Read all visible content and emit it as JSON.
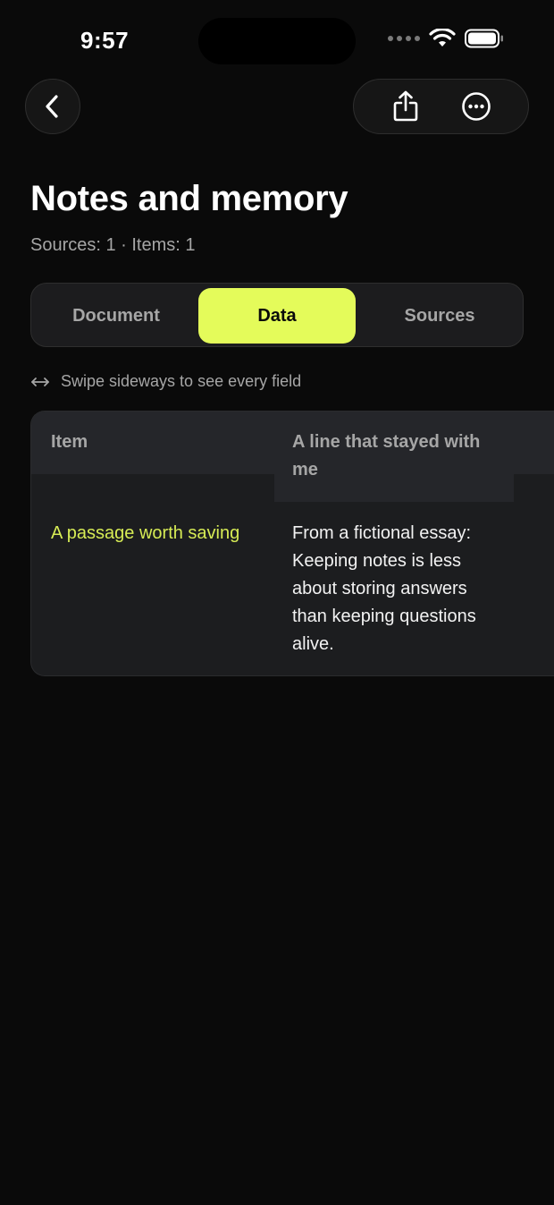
{
  "status_bar": {
    "time": "9:57"
  },
  "nav": {
    "back_icon": "chevron-left-icon",
    "share_icon": "share-icon",
    "more_icon": "ellipsis-circle-icon"
  },
  "page": {
    "title": "Notes and memory",
    "meta": "Sources: 1 · Items: 1"
  },
  "tabs": [
    {
      "label": "Document",
      "active": false
    },
    {
      "label": "Data",
      "active": true
    },
    {
      "label": "Sources",
      "active": false
    }
  ],
  "hint": {
    "icon": "swap-horizontal-icon",
    "text": "Swipe sideways to see every field"
  },
  "table": {
    "columns": [
      "Item",
      "A line that stayed with me"
    ],
    "rows": [
      {
        "item": "A passage worth saving",
        "quote": "From a fictional essay: Keeping notes is less about storing answers than keeping questions alive."
      }
    ]
  },
  "colors": {
    "accent": "#e4fb5a",
    "item_text": "#d7ec55",
    "background": "#0a0a0a",
    "card": "#1c1d1f",
    "header": "#25262a"
  }
}
